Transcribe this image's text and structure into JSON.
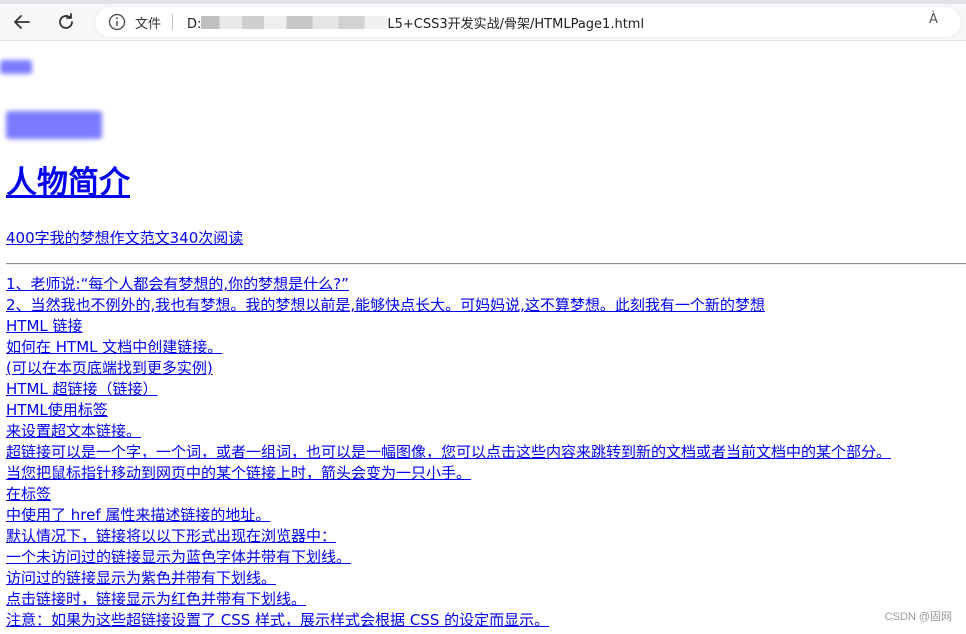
{
  "browser": {
    "file_label": "文件",
    "url_prefix": "D:",
    "url_suffix": "L5+CSS3开发实战/骨架/HTMLPage1.html",
    "read_aloud": "À"
  },
  "page": {
    "top_small": "",
    "heading_blurred": "",
    "heading_main": "人物简介",
    "read_link": "400字我的梦想作文范文340次阅读",
    "lines": [
      "1、老师说:“每个人都会有梦想的,你的梦想是什么?” ",
      "2、当然我也不例外的,我也有梦想。我的梦想以前是,能够快点长大。可妈妈说,这不算梦想。此刻我有一个新的梦想",
      "HTML 链接",
      "如何在 HTML 文档中创建链接。",
      "(可以在本页底端找到更多实例)",
      "HTML 超链接（链接）",
      "HTML使用标签",
      "来设置超文本链接。",
      "超链接可以是一个字，一个词，或者一组词，也可以是一幅图像，您可以点击这些内容来跳转到新的文档或者当前文档中的某个部分。",
      "当您把鼠标指针移动到网页中的某个链接上时，箭头会变为一只小手。",
      "在标签",
      "中使用了 href 属性来描述链接的地址。",
      "默认情况下，链接将以以下形式出现在浏览器中：",
      "一个未访问过的链接显示为蓝色字体并带有下划线。",
      "访问过的链接显示为紫色并带有下划线。",
      "点击链接时，链接显示为红色并带有下划线。",
      "注意：如果为这些超链接设置了 CSS 样式，展示样式会根据 CSS 的设定而显示。"
    ],
    "watermark": "CSDN @固网"
  }
}
